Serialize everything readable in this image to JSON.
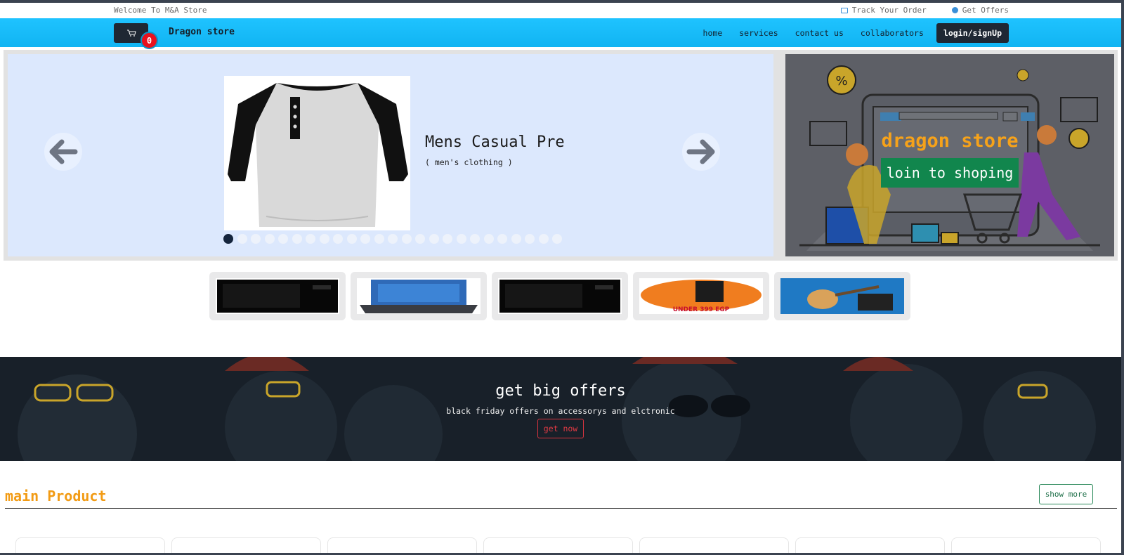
{
  "topbar": {
    "welcome": "Welcome To M&A Store",
    "track_order": "Track Your Order",
    "get_offers": "Get Offers"
  },
  "nav": {
    "cart_count": "0",
    "brand": "Dragon store",
    "links": [
      "home",
      "services",
      "contact us",
      "collaborators"
    ],
    "login": "login/signUp"
  },
  "slider": {
    "product_title": "Mens Casual Pre",
    "product_category": "( men's clothing )",
    "total_slides": 25,
    "active_slide": 1
  },
  "promo": {
    "title": "dragon store",
    "button": "loin to shoping"
  },
  "thumbnails": [
    {
      "name": "microwave",
      "color": "#050505"
    },
    {
      "name": "laptop",
      "color": "#2f6ab8"
    },
    {
      "name": "microwave",
      "color": "#050505"
    },
    {
      "name": "offer-banner",
      "color": "#f07d1f"
    },
    {
      "name": "guitar-speakers",
      "color": "#1f79c4"
    }
  ],
  "thumb_text": "UNDER 399 EGP",
  "banner": {
    "title": "get big offers",
    "subtitle": "black friday offers on accessorys and elctronic",
    "button": "get now"
  },
  "section": {
    "title": "main Product",
    "show_more": "show more"
  },
  "colors": {
    "nav_bg": "#11b4f2",
    "accent_orange": "#f29b14",
    "promo_green": "#11864d",
    "badge_red": "#e8111d"
  }
}
